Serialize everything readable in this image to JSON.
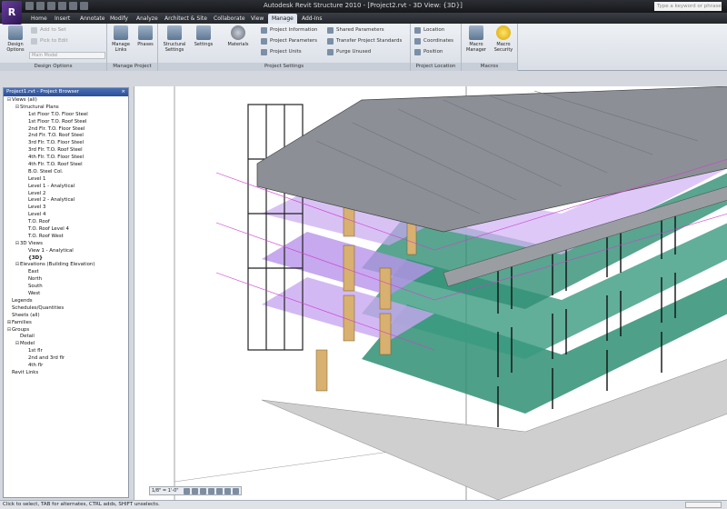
{
  "app": {
    "title": "Autodesk Revit Structure 2010 - [Project2.rvt - 3D View: {3D}]",
    "logo_letter": "R",
    "search_placeholder": "Type a keyword or phrase"
  },
  "tabs": [
    {
      "label": "Home"
    },
    {
      "label": "Insert"
    },
    {
      "label": "Annotate"
    },
    {
      "label": "Modify"
    },
    {
      "label": "Analyze"
    },
    {
      "label": "Architect & Site"
    },
    {
      "label": "Collaborate"
    },
    {
      "label": "View"
    },
    {
      "label": "Manage",
      "active": true
    },
    {
      "label": "Add-Ins"
    }
  ],
  "ribbon": {
    "design_options": {
      "panel_label": "Design Options",
      "big_button": "Design Options",
      "add_to_set": "Add to Set",
      "pick_to_edit": "Pick to Edit",
      "main_model": "Main Model"
    },
    "manage_project": {
      "panel_label": "Manage Project",
      "manage_links": "Manage Links",
      "phases": "Phases"
    },
    "project_settings": {
      "panel_label": "Project Settings",
      "structural_settings": "Structural Settings",
      "settings": "Settings",
      "materials": "Materials",
      "project_information": "Project Information",
      "project_parameters": "Project Parameters",
      "project_units": "Project Units",
      "shared_parameters": "Shared Parameters",
      "transfer_project_standards": "Transfer Project Standards",
      "purge_unused": "Purge Unused"
    },
    "project_location": {
      "panel_label": "Project Location",
      "location": "Location",
      "coordinates": "Coordinates",
      "position": "Position"
    },
    "macros": {
      "panel_label": "Macros",
      "macro_manager": "Macro Manager",
      "macro_security": "Macro Security"
    }
  },
  "project_browser": {
    "title": "Project1.rvt - Project Browser",
    "close": "×",
    "items": [
      {
        "label": "Views (all)",
        "level": 0,
        "toggle": "⊟"
      },
      {
        "label": "Structural Plans",
        "level": 1,
        "toggle": "⊟"
      },
      {
        "label": "1st Floor T.O. Floor Steel",
        "level": 2,
        "toggle": ""
      },
      {
        "label": "1st Floor T.O. Roof Steel",
        "level": 2,
        "toggle": ""
      },
      {
        "label": "2nd Flr. T.O. Floor Steel",
        "level": 2,
        "toggle": ""
      },
      {
        "label": "2nd Flr. T.O. Roof Steel",
        "level": 2,
        "toggle": ""
      },
      {
        "label": "3rd Flr. T.O. Floor Steel",
        "level": 2,
        "toggle": ""
      },
      {
        "label": "3rd Flr. T.O. Roof Steel",
        "level": 2,
        "toggle": ""
      },
      {
        "label": "4th Flr. T.O. Floor Steel",
        "level": 2,
        "toggle": ""
      },
      {
        "label": "4th Flr. T.O. Roof Steel",
        "level": 2,
        "toggle": ""
      },
      {
        "label": "B.O. Steel Col.",
        "level": 2,
        "toggle": ""
      },
      {
        "label": "Level 1",
        "level": 2,
        "toggle": ""
      },
      {
        "label": "Level 1 - Analytical",
        "level": 2,
        "toggle": ""
      },
      {
        "label": "Level 2",
        "level": 2,
        "toggle": ""
      },
      {
        "label": "Level 2 - Analytical",
        "level": 2,
        "toggle": ""
      },
      {
        "label": "Level 3",
        "level": 2,
        "toggle": ""
      },
      {
        "label": "Level 4",
        "level": 2,
        "toggle": ""
      },
      {
        "label": "T.O. Roof",
        "level": 2,
        "toggle": ""
      },
      {
        "label": "T.O. Roof Level 4",
        "level": 2,
        "toggle": ""
      },
      {
        "label": "T.O. Roof West",
        "level": 2,
        "toggle": ""
      },
      {
        "label": "3D Views",
        "level": 1,
        "toggle": "⊟"
      },
      {
        "label": "View 1 - Analytical",
        "level": 2,
        "toggle": ""
      },
      {
        "label": "{3D}",
        "level": 2,
        "toggle": "",
        "selected": true
      },
      {
        "label": "Elevations (Building Elevation)",
        "level": 1,
        "toggle": "⊟"
      },
      {
        "label": "East",
        "level": 2,
        "toggle": ""
      },
      {
        "label": "North",
        "level": 2,
        "toggle": ""
      },
      {
        "label": "South",
        "level": 2,
        "toggle": ""
      },
      {
        "label": "West",
        "level": 2,
        "toggle": ""
      },
      {
        "label": "Legends",
        "level": 0,
        "toggle": ""
      },
      {
        "label": "Schedules/Quantities",
        "level": 0,
        "toggle": ""
      },
      {
        "label": "Sheets (all)",
        "level": 0,
        "toggle": ""
      },
      {
        "label": "Families",
        "level": 0,
        "toggle": "⊞"
      },
      {
        "label": "Groups",
        "level": 0,
        "toggle": "⊟"
      },
      {
        "label": "Detail",
        "level": 1,
        "toggle": ""
      },
      {
        "label": "Model",
        "level": 1,
        "toggle": "⊟"
      },
      {
        "label": "1st flr",
        "level": 2,
        "toggle": ""
      },
      {
        "label": "2nd and 3rd flr",
        "level": 2,
        "toggle": ""
      },
      {
        "label": "4th flr",
        "level": 2,
        "toggle": ""
      },
      {
        "label": "Revit Links",
        "level": 0,
        "toggle": ""
      }
    ]
  },
  "view_control": {
    "scale": "1/8\" = 1'-0\""
  },
  "status": {
    "text": "Click to select, TAB for alternates, CTRL adds, SHIFT unselects."
  },
  "colors": {
    "ribbon_bg": "#e3e8ee",
    "title_bg": "#1f2226",
    "browser_header": "#3a5fa8",
    "floor_green": "#2f8f73",
    "floor_purple": "#c8a8f0",
    "roof_gray": "#8c9096",
    "wall_tan": "#d8b070"
  }
}
